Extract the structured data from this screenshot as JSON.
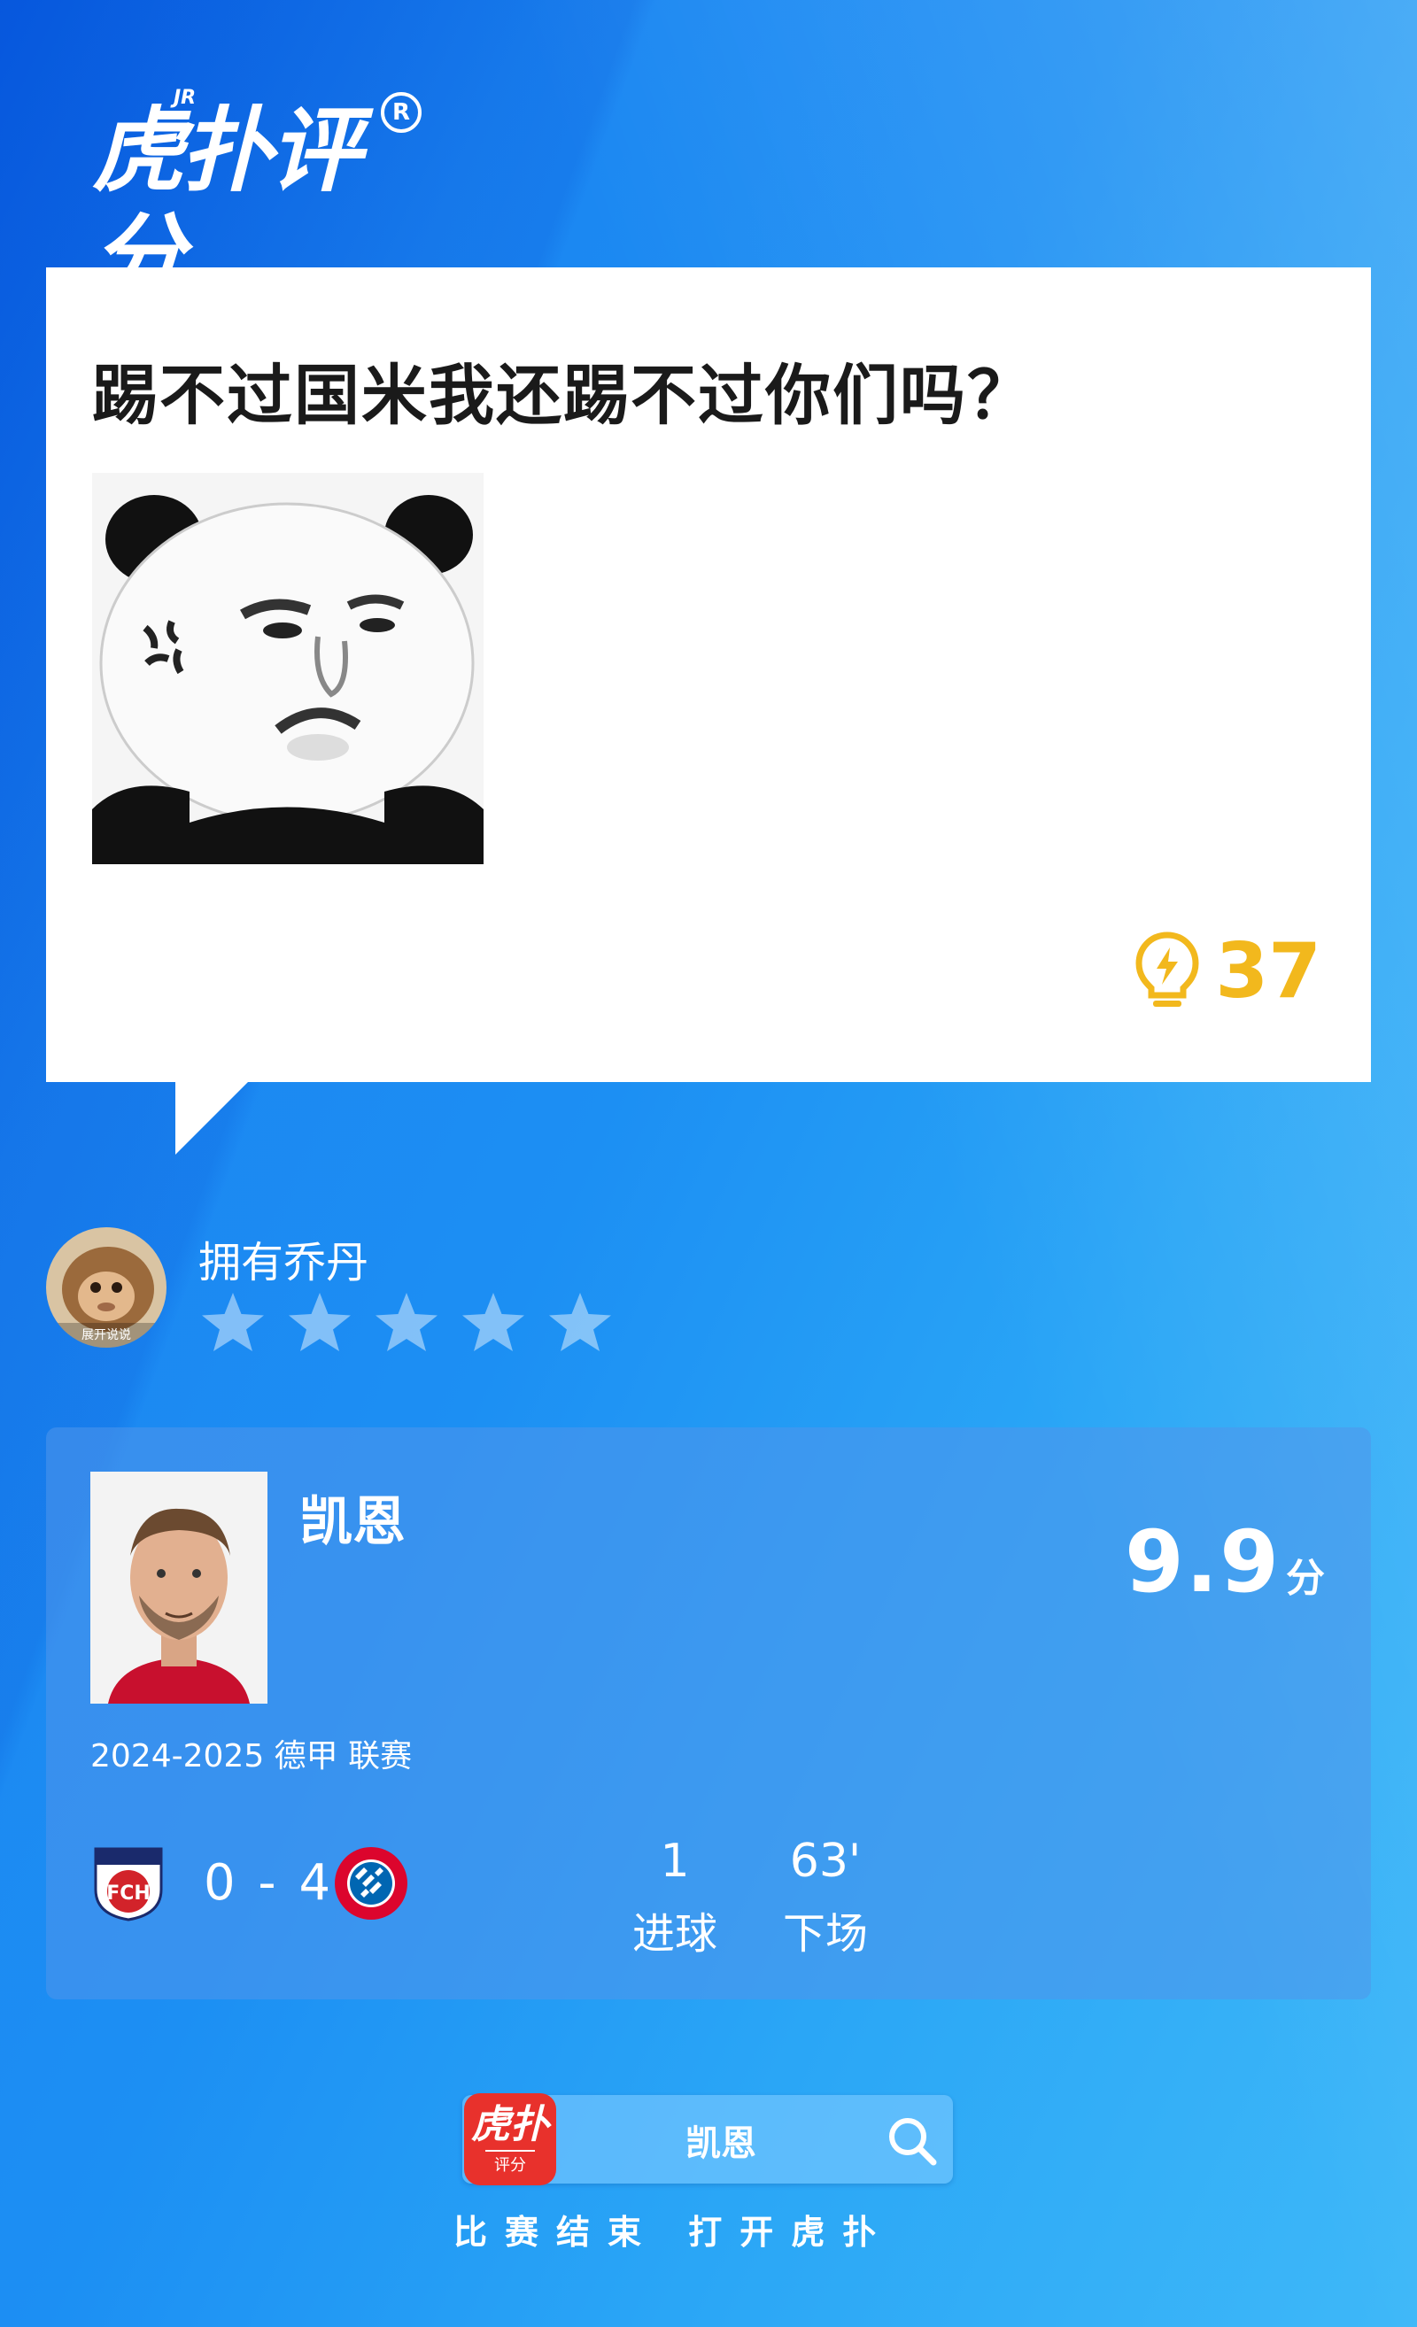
{
  "brand": {
    "logo_text": "虎扑评分",
    "logo_sup": "JR",
    "registered": "R"
  },
  "comment": {
    "text": "踢不过国米我还踢不过你们吗？",
    "likes": "37",
    "like_icon": "lightbulb-bolt-icon"
  },
  "user": {
    "name": "拥有乔丹",
    "avatar_caption": "展开说说",
    "rating_stars": 5,
    "rating_filled": 0
  },
  "player": {
    "name": "凯恩",
    "score": "9.9",
    "score_unit": "分",
    "season": "2024-2025 德甲 联赛",
    "home_team": "FCH",
    "away_team": "FC BAYERN MÜNCHEN",
    "match_score": "0 - 4",
    "stats": [
      {
        "value": "1",
        "label": "进球"
      },
      {
        "value": "63'",
        "label": "下场"
      }
    ]
  },
  "search_bar": {
    "app_name": "虎扑",
    "app_sub": "评分",
    "query": "凯恩",
    "icon": "search-icon"
  },
  "caption": "比赛结束 打开虎扑",
  "colors": {
    "like": "#f2b81d",
    "background": "#1c8ff3",
    "app_red": "#e8312c"
  }
}
